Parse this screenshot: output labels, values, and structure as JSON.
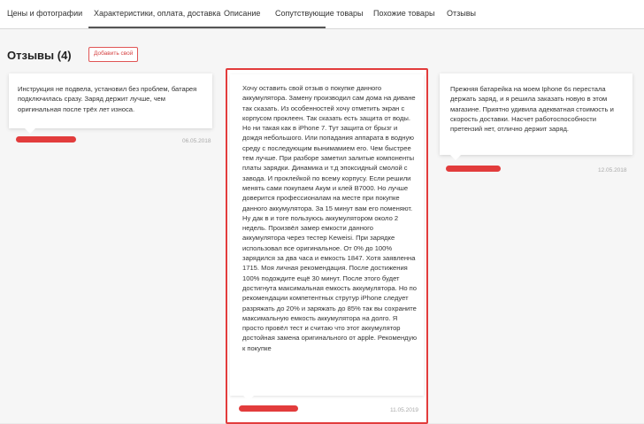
{
  "tabs": [
    {
      "label": "Цены и фотографии"
    },
    {
      "label": "Характеристики, оплата, доставка"
    },
    {
      "label": "Описание"
    },
    {
      "label": "Сопутствующие товары"
    },
    {
      "label": "Похожие товары"
    },
    {
      "label": "Отзывы"
    }
  ],
  "reviews_section": {
    "title": "Отзывы (4)",
    "add_button": "Добавить свой"
  },
  "reviews": [
    {
      "text": "Инструкция не подвела, установил без проблем, батарея подключилась сразу. Заряд держит лучше, чем оригинальная после трёх лет износа.",
      "date": "06.05.2018"
    },
    {
      "text": "Хочу оставить свой отзыв о покупке данного аккумулятора. Замену производил сам дома на диване так сказать. Из особенностей хочу отметить экран с корпусом проклеен. Так сказать есть защита от воды. Но ни такая как в iPhone 7. Тут защита от брызг и дождя небольшого. Или попадания аппарата в водную среду с последующим вынимамием его. Чем быстрее тем лучше. При разборе заметил залитые компоненты платы зарядки. Динамика и т.д эпоксидный смолой с завода. И проклейкой по всему корпусу. Если решили менять сами покупаем Акум и клей В7000. Но лучше доверится профессионалам на месте при покупке данного аккумулятора. За 15 минут вам его поменяют. Ну дак в и тоге пользуюсь аккумулятором около 2 недель. Произвёл замер емкости данного аккумулятора через тестер Keweisi. При зарядке использовал все оригинальное. От 0% до 100% зарядился за два часа и емкость 1847. Хотя заявленна 1715. Моя личная рекомендация. После достижения 100% подождите ещё 30 минут. После этого будет достигнута максимальная емкость аккумулятора. Но по рекомендации компетентных струтур iPhone следует разряжать до 20% и заряжать до 85% так вы сохраните максимальную емкость аккумулятора на долго. Я просто провёл тест и считаю что этот аккумулятор достойная замена оригинального от apple. Рекомендую к покупке",
      "date": "11.05.2019"
    },
    {
      "text": "Прежняя батарейка на моем Iphone 6s перестала держать заряд, и я решила заказать новую в этом магазине. Приятно удивила адекватная стоимость и скорость доставки. Насчет работоспособности претензий нет, отлично держит заряд.",
      "date": "12.05.2018"
    }
  ],
  "colors": {
    "accent": "#e23c3c",
    "tab_underline": "#555555",
    "date_text": "#aaaaaa"
  }
}
